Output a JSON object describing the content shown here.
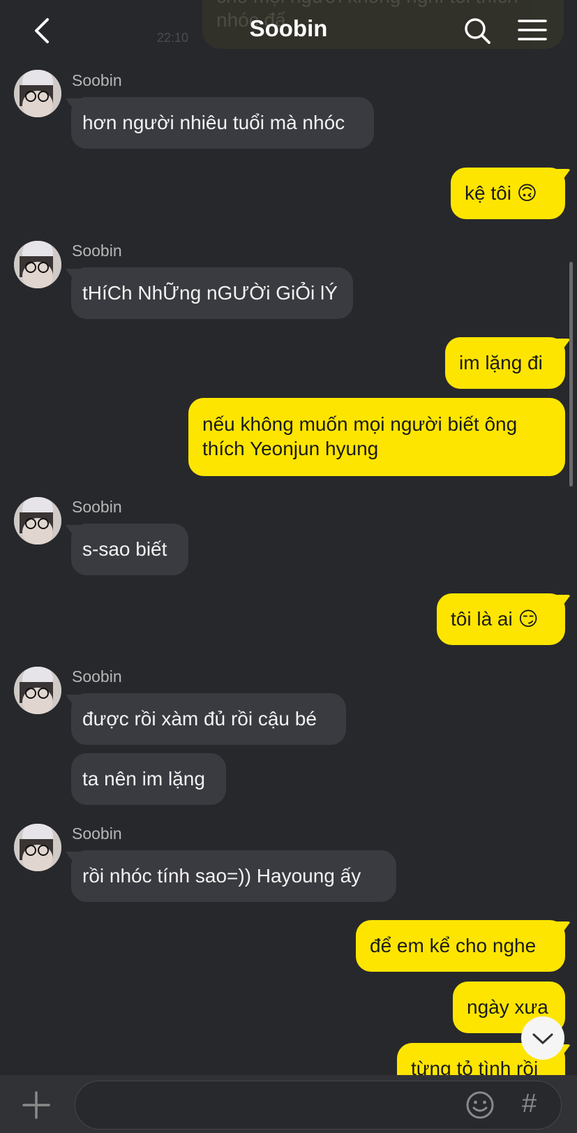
{
  "header": {
    "title": "Soobin",
    "partial_message": "cho mọi người không nghĩ tôi thích nhóc đấ",
    "partial_time": "22:10"
  },
  "messages": [
    {
      "side": "in",
      "sender": "Soobin",
      "text": "hơn người nhiêu tuổi mà nhóc"
    },
    {
      "side": "out",
      "text": "kệ tôi 🙃"
    },
    {
      "side": "in",
      "sender": "Soobin",
      "text": "tHíCh NhỮng nGƯỜi GiỎi lÝ"
    },
    {
      "side": "out",
      "text": "im lặng đi"
    },
    {
      "side": "out",
      "text": "nếu không muốn mọi người biết ông thích Yeonjun hyung",
      "line1": "nếu không muốn mọi người biết ông",
      "line2": "thích Yeonjun hyung"
    },
    {
      "side": "in",
      "sender": "Soobin",
      "text": "s-sao biết"
    },
    {
      "side": "out",
      "text": "tôi là ai 😏"
    },
    {
      "side": "in",
      "sender": "Soobin",
      "text": "được rồi xàm đủ rồi cậu bé"
    },
    {
      "side": "in",
      "text": "ta nên im lặng"
    },
    {
      "side": "in",
      "sender": "Soobin",
      "text": "rồi nhóc tính sao=)) Hayoung ấy"
    },
    {
      "side": "out",
      "text": "để em kể cho nghe"
    },
    {
      "side": "out",
      "text": "ngày xưa"
    },
    {
      "side": "out",
      "text": "từng tỏ tình rồi"
    }
  ],
  "icons": {
    "back": "chevron-left-icon",
    "search": "search-icon",
    "menu": "hamburger-menu-icon",
    "scroll_down": "chevron-down-icon",
    "attach": "plus-icon",
    "emoji": "smiley-icon",
    "hashtag": "hash-icon"
  },
  "composer": {
    "placeholder": "",
    "hash_label": "#"
  },
  "colors": {
    "background": "#27282c",
    "outgoing_bubble": "#fee500",
    "incoming_bubble": "#3a3b40"
  }
}
